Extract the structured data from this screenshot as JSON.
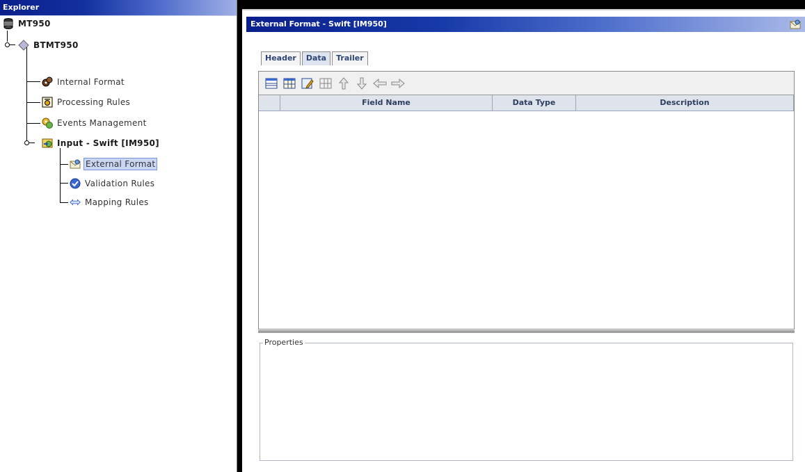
{
  "explorer": {
    "title": "Explorer",
    "tree": {
      "root": {
        "label": "MT950",
        "icon": "database-icon"
      },
      "level1": {
        "label": "BTMT950",
        "icon": "diamond-icon"
      },
      "level2": [
        {
          "label": "Internal Format",
          "icon": "gears-icon"
        },
        {
          "label": "Processing Rules",
          "icon": "rules-doc-icon"
        },
        {
          "label": "Events Management",
          "icon": "events-gear-icon"
        },
        {
          "label": "Input - Swift [IM950]",
          "icon": "input-swift-icon"
        }
      ],
      "level3": [
        {
          "label": "External Format",
          "icon": "envelope-icon",
          "selected": true
        },
        {
          "label": "Validation Rules",
          "icon": "check-circle-icon"
        },
        {
          "label": "Mapping Rules",
          "icon": "mapping-arrows-icon"
        }
      ]
    }
  },
  "main": {
    "title": "External Format - Swift [IM950]",
    "corner_icon": "envelope-icon",
    "tabs": [
      {
        "label": "Header",
        "active": false
      },
      {
        "label": "Data",
        "active": true
      },
      {
        "label": "Trailer",
        "active": false
      }
    ],
    "toolbar": [
      {
        "name": "add-row-icon"
      },
      {
        "name": "insert-table-icon"
      },
      {
        "name": "edit-icon"
      },
      {
        "name": "delete-icon"
      },
      {
        "name": "move-up-icon"
      },
      {
        "name": "move-down-icon"
      },
      {
        "name": "move-left-icon"
      },
      {
        "name": "move-right-icon"
      }
    ],
    "grid": {
      "columns": [
        "Field Name",
        "Data Type",
        "Description"
      ],
      "rows": []
    },
    "properties": {
      "legend": "Properties"
    }
  }
}
